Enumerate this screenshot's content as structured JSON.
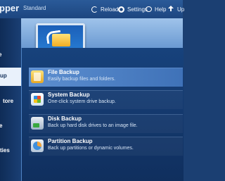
{
  "app": {
    "title": "pper",
    "edition": "Standard"
  },
  "toolbar": {
    "reload_label": "Reload",
    "settings_label": "Settings",
    "help_label": "Help",
    "upgrade_label": "Up"
  },
  "sidebar": {
    "items": [
      {
        "label": "e",
        "icon": "home-icon"
      },
      {
        "label": "up",
        "active": true
      },
      {
        "label": "tore"
      },
      {
        "label": "e"
      },
      {
        "label": "ties"
      }
    ]
  },
  "tasks": [
    {
      "title": "File Backup",
      "description": "Easily backup files and folders.",
      "icon": "file-backup-icon",
      "highlighted": true
    },
    {
      "title": "System Backup",
      "description": "One-click system drive backup.",
      "icon": "system-backup-icon"
    },
    {
      "title": "Disk Backup",
      "description": "Back up hard disk drives to an image file.",
      "icon": "disk-backup-icon"
    },
    {
      "title": "Partition Backup",
      "description": "Back up partitions or dynamic volumes.",
      "icon": "partition-backup-icon"
    }
  ],
  "colors": {
    "titlebar": "#2a5a98",
    "sidebar": "#0f2c57",
    "active_sidebar": "#e9f1fb",
    "highlight": "#5d8fd0"
  }
}
